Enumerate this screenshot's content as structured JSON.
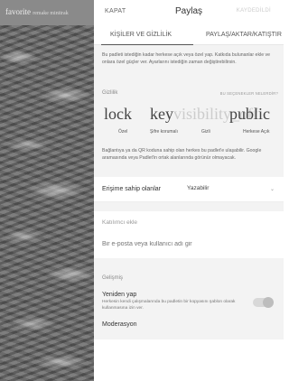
{
  "background": {
    "title": "favorite",
    "subtitle": "remake minitrak"
  },
  "header": {
    "close_label": "KAPAT",
    "title": "Paylaş",
    "save_label": "KAYDEDİLDİ"
  },
  "tabs": [
    {
      "label": "KİŞİLER VE GİZLİLİK",
      "active": true
    },
    {
      "label": "PAYLAŞ/AKTAR/KATIŞTIR",
      "active": false
    }
  ],
  "intro_text": "Bu padleti istediğin kadar herkese açık veya özel yap. Katkıda bulunanlar ekle ve onlara özel güçler ver. Ayarlarını istediğin zaman değiştirebilirsin.",
  "privacy": {
    "title": "Gizlilik",
    "options_link": "BU SEÇENEKLER NELERDİR?",
    "glyphs": {
      "private": "lock",
      "password": "key",
      "secret": "visibility_off",
      "public": "public"
    },
    "options": [
      {
        "label": "Özel",
        "selected": false
      },
      {
        "label": "Şifre korumalı",
        "selected": false
      },
      {
        "label": "Gizli",
        "selected": false
      },
      {
        "label": "Herkese Açık",
        "selected": true
      }
    ],
    "description": "Bağlantıya ya da QR koduna sahip olan herkes bu padlet'e ulaşabilir. Google aramasında veya Padlet'in ortak alanlarında görünür olmayacak."
  },
  "access": {
    "label": "Erişime sahip olanlar",
    "value": "Yazabilir",
    "chevron_icon": "chevron-down-icon"
  },
  "invite": {
    "title": "Katılımcı ekle",
    "placeholder": "Bir e-posta veya kullanıcı adı gir"
  },
  "advanced": {
    "title": "Gelişmiş",
    "remake_title": "Yeniden yap",
    "remake_desc": "Herkesin kendi çalışmalarında bu padletin bir kopyasını şablon olarak kullanmasına izin ver.",
    "remake_enabled": true,
    "moderation_title": "Moderasyon"
  },
  "colors": {
    "panel_bg": "#ffffff",
    "section_bg": "#f3f3f3",
    "toggle_track": "#d8d8d8",
    "toggle_knob": "#bdbdbd"
  }
}
